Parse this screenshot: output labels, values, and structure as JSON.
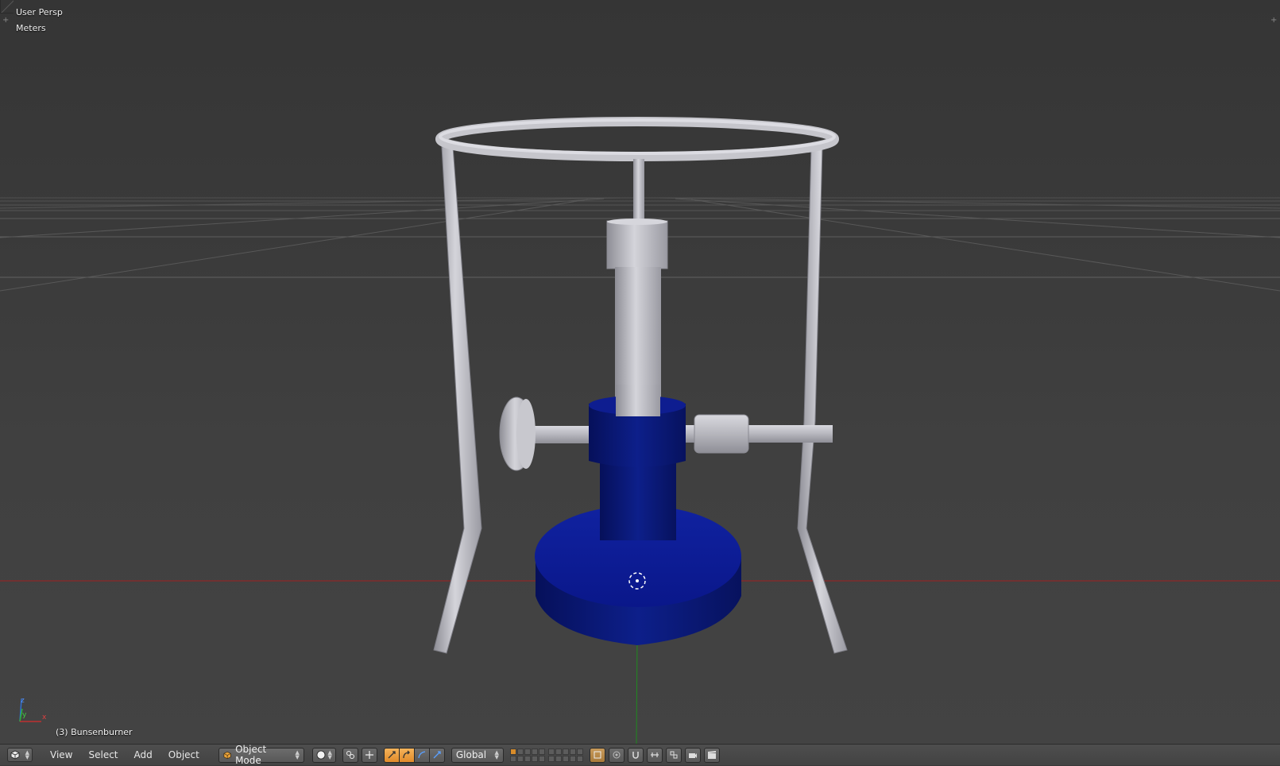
{
  "viewport": {
    "view_name": "User Persp",
    "units": "Meters",
    "object_info": "(3) Bunsenburner"
  },
  "axes_gizmo": {
    "z": "z",
    "y": "y",
    "x": "x"
  },
  "header": {
    "menus": [
      "View",
      "Select",
      "Add",
      "Object"
    ],
    "mode": "Object Mode",
    "orientation": "Global",
    "icons": {
      "editor_type": "cube-icon",
      "shading": "solid-sphere-icon",
      "pivot": "pivot-point-icon",
      "manipulator": "manipulator-icon",
      "translate": "translate-icon",
      "rotate": "rotate-icon",
      "scale": "scale-icon",
      "render_layers": "render-layer-icon",
      "proportional": "proportional-edit-icon",
      "snap": "magnet-icon",
      "snap_target": "snap-element-icon",
      "opengl_render": "camera-icon",
      "opengl_anim": "clapper-icon"
    },
    "colors": {
      "active_button": "#e18b2a",
      "header_bg": "#474747"
    }
  },
  "colors": {
    "burner_blue": "#0a1a7a",
    "metal": "#b8b8c0",
    "x_axis": "#a02020",
    "y_axis": "#1f8a1f",
    "grid": "#5a5a5a"
  }
}
